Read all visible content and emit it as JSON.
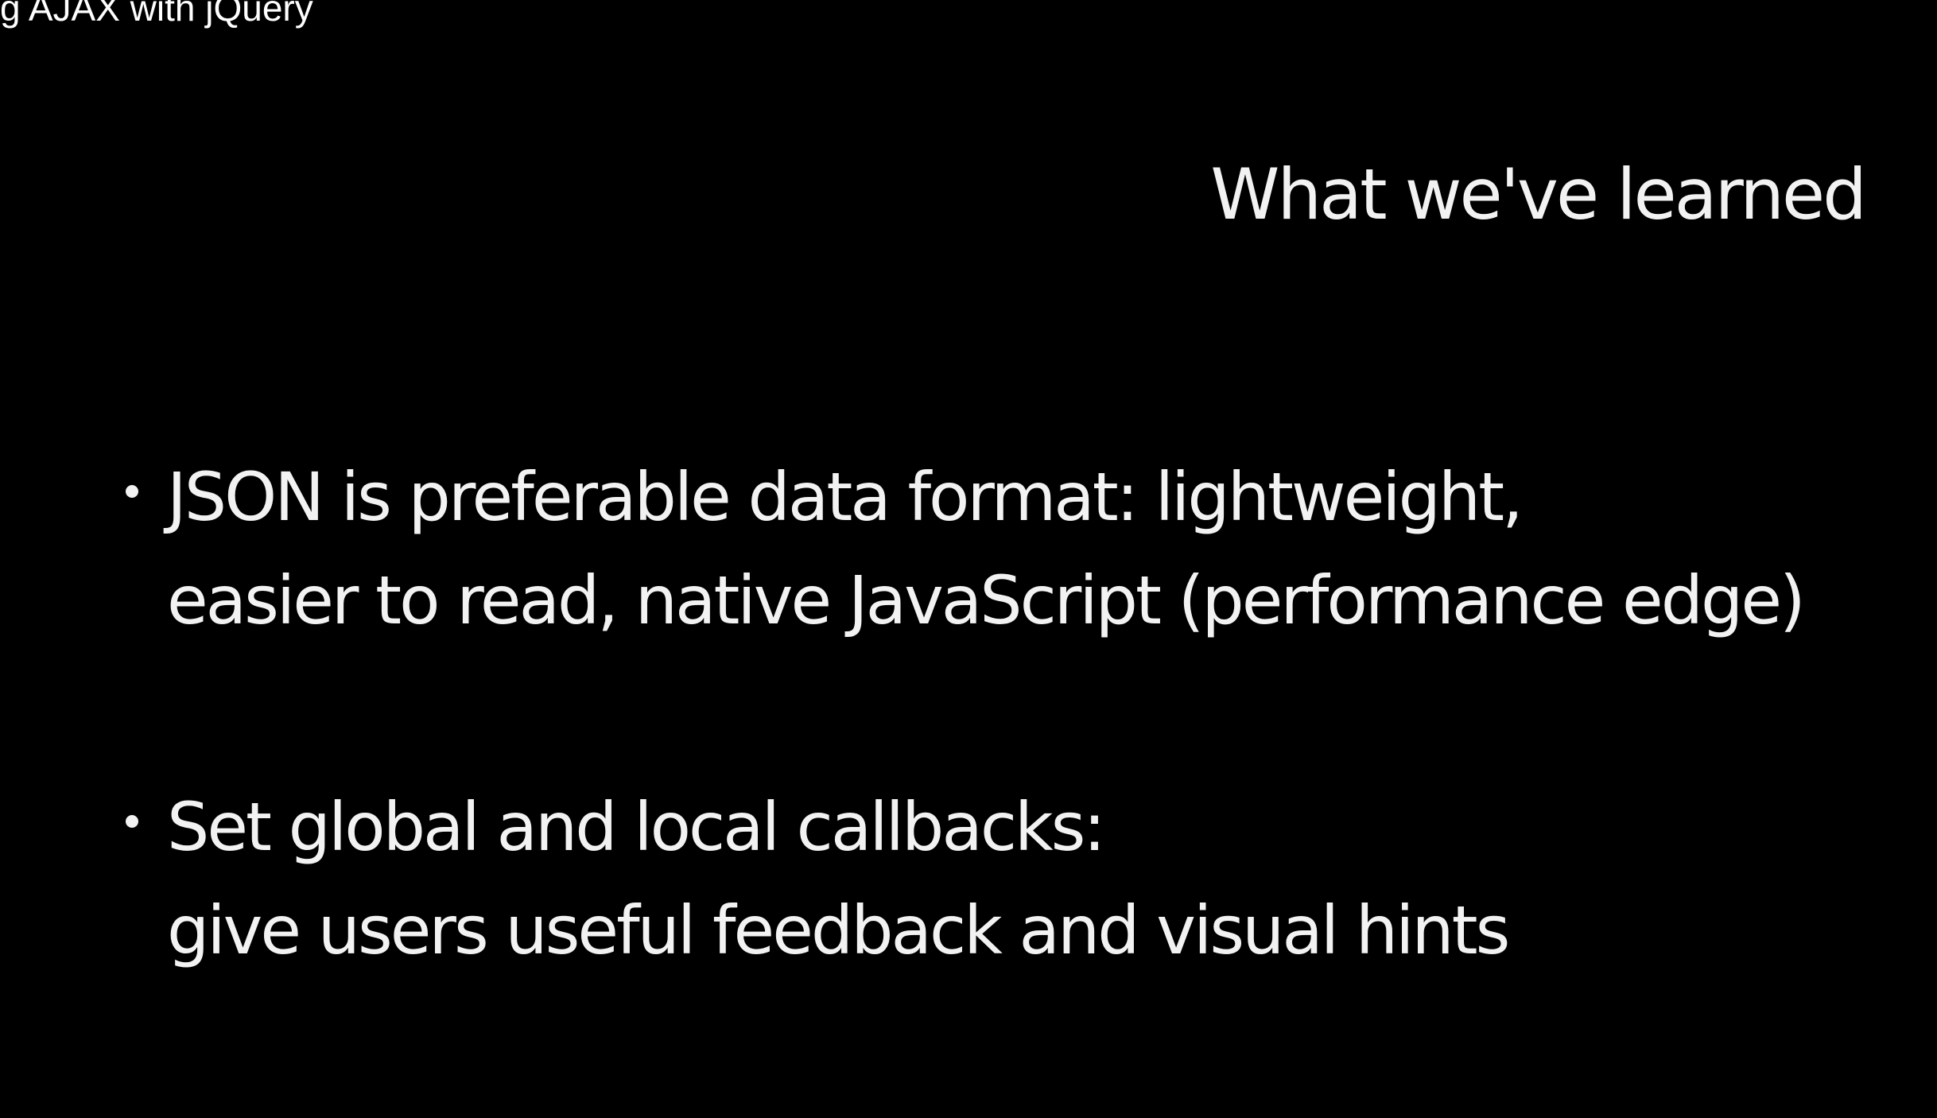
{
  "video": {
    "title": "g AJAX with jQuery"
  },
  "slide": {
    "heading": "What we've learned",
    "bullets": [
      {
        "lines": [
          "JSON is preferable data format: lightweight,",
          "easier to read, native JavaScript (performance edge)"
        ]
      },
      {
        "lines": [
          "Set global and local callbacks:",
          "give users useful feedback and visual hints"
        ]
      }
    ]
  },
  "colors": {
    "background": "#000000",
    "text": "#f2f2f2"
  }
}
